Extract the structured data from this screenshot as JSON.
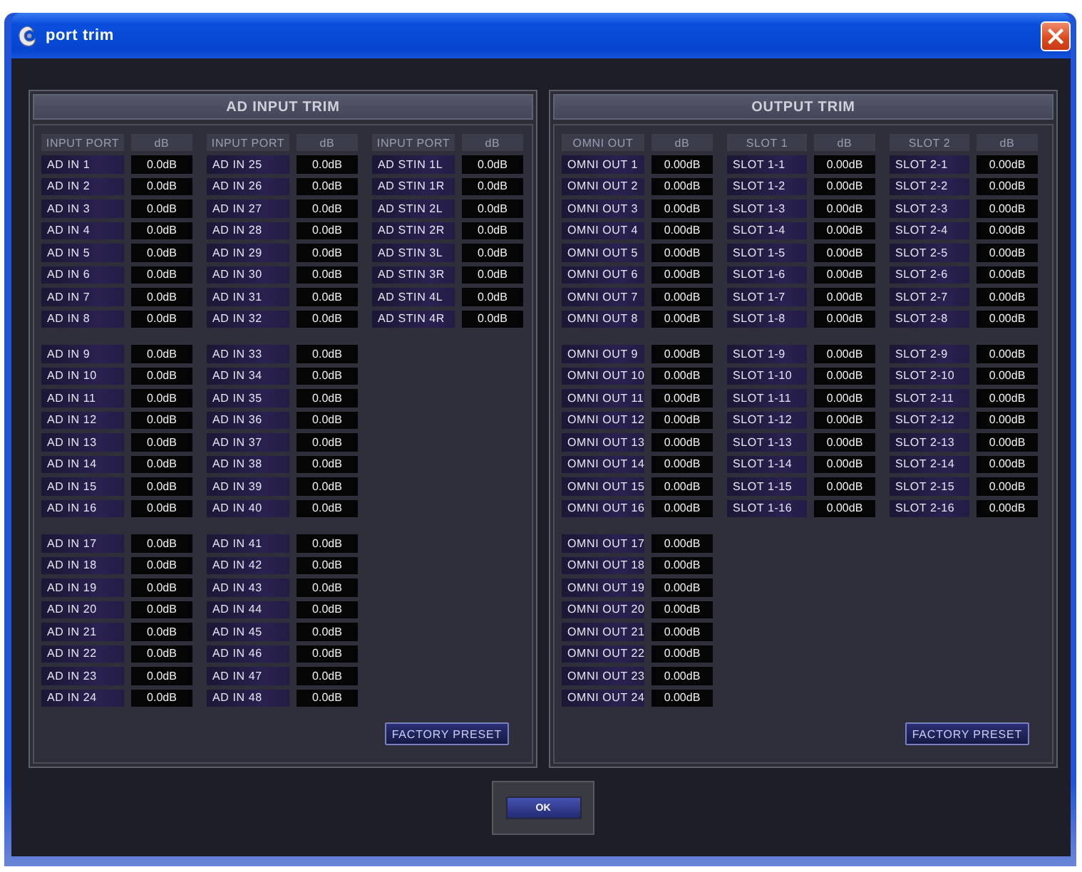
{
  "window": {
    "title": "port trim"
  },
  "panels": [
    {
      "title": "AD INPUT TRIM",
      "columns": [
        {
          "name_header": "INPUT PORT",
          "value_header": "dB",
          "blocks": [
            {
              "rows": [
                {
                  "name": "AD IN 1",
                  "trim": "0.0dB"
                },
                {
                  "name": "AD IN 2",
                  "trim": "0.0dB"
                },
                {
                  "name": "AD IN 3",
                  "trim": "0.0dB"
                },
                {
                  "name": "AD IN 4",
                  "trim": "0.0dB"
                },
                {
                  "name": "AD IN 5",
                  "trim": "0.0dB"
                },
                {
                  "name": "AD IN 6",
                  "trim": "0.0dB"
                },
                {
                  "name": "AD IN 7",
                  "trim": "0.0dB"
                },
                {
                  "name": "AD IN 8",
                  "trim": "0.0dB"
                }
              ]
            },
            {
              "rows": [
                {
                  "name": "AD IN 9",
                  "trim": "0.0dB"
                },
                {
                  "name": "AD IN 10",
                  "trim": "0.0dB"
                },
                {
                  "name": "AD IN 11",
                  "trim": "0.0dB"
                },
                {
                  "name": "AD IN 12",
                  "trim": "0.0dB"
                },
                {
                  "name": "AD IN 13",
                  "trim": "0.0dB"
                },
                {
                  "name": "AD IN 14",
                  "trim": "0.0dB"
                },
                {
                  "name": "AD IN 15",
                  "trim": "0.0dB"
                },
                {
                  "name": "AD IN 16",
                  "trim": "0.0dB"
                }
              ]
            },
            {
              "rows": [
                {
                  "name": "AD IN 17",
                  "trim": "0.0dB"
                },
                {
                  "name": "AD IN 18",
                  "trim": "0.0dB"
                },
                {
                  "name": "AD IN 19",
                  "trim": "0.0dB"
                },
                {
                  "name": "AD IN 20",
                  "trim": "0.0dB"
                },
                {
                  "name": "AD IN 21",
                  "trim": "0.0dB"
                },
                {
                  "name": "AD IN 22",
                  "trim": "0.0dB"
                },
                {
                  "name": "AD IN 23",
                  "trim": "0.0dB"
                },
                {
                  "name": "AD IN 24",
                  "trim": "0.0dB"
                }
              ]
            }
          ]
        },
        {
          "name_header": "INPUT PORT",
          "value_header": "dB",
          "blocks": [
            {
              "rows": [
                {
                  "name": "AD IN 25",
                  "trim": "0.0dB"
                },
                {
                  "name": "AD IN 26",
                  "trim": "0.0dB"
                },
                {
                  "name": "AD IN 27",
                  "trim": "0.0dB"
                },
                {
                  "name": "AD IN 28",
                  "trim": "0.0dB"
                },
                {
                  "name": "AD IN 29",
                  "trim": "0.0dB"
                },
                {
                  "name": "AD IN 30",
                  "trim": "0.0dB"
                },
                {
                  "name": "AD IN 31",
                  "trim": "0.0dB"
                },
                {
                  "name": "AD IN 32",
                  "trim": "0.0dB"
                }
              ]
            },
            {
              "rows": [
                {
                  "name": "AD IN 33",
                  "trim": "0.0dB"
                },
                {
                  "name": "AD IN 34",
                  "trim": "0.0dB"
                },
                {
                  "name": "AD IN 35",
                  "trim": "0.0dB"
                },
                {
                  "name": "AD IN 36",
                  "trim": "0.0dB"
                },
                {
                  "name": "AD IN 37",
                  "trim": "0.0dB"
                },
                {
                  "name": "AD IN 38",
                  "trim": "0.0dB"
                },
                {
                  "name": "AD IN 39",
                  "trim": "0.0dB"
                },
                {
                  "name": "AD IN 40",
                  "trim": "0.0dB"
                }
              ]
            },
            {
              "rows": [
                {
                  "name": "AD IN 41",
                  "trim": "0.0dB"
                },
                {
                  "name": "AD IN 42",
                  "trim": "0.0dB"
                },
                {
                  "name": "AD IN 43",
                  "trim": "0.0dB"
                },
                {
                  "name": "AD IN 44",
                  "trim": "0.0dB"
                },
                {
                  "name": "AD IN 45",
                  "trim": "0.0dB"
                },
                {
                  "name": "AD IN 46",
                  "trim": "0.0dB"
                },
                {
                  "name": "AD IN 47",
                  "trim": "0.0dB"
                },
                {
                  "name": "AD IN 48",
                  "trim": "0.0dB"
                }
              ]
            }
          ]
        },
        {
          "name_header": "INPUT PORT",
          "value_header": "dB",
          "blocks": [
            {
              "rows": [
                {
                  "name": "AD STIN 1L",
                  "trim": "0.0dB"
                },
                {
                  "name": "AD STIN 1R",
                  "trim": "0.0dB"
                },
                {
                  "name": "AD STIN 2L",
                  "trim": "0.0dB"
                },
                {
                  "name": "AD STIN 2R",
                  "trim": "0.0dB"
                },
                {
                  "name": "AD STIN 3L",
                  "trim": "0.0dB"
                },
                {
                  "name": "AD STIN 3R",
                  "trim": "0.0dB"
                },
                {
                  "name": "AD STIN 4L",
                  "trim": "0.0dB"
                },
                {
                  "name": "AD STIN 4R",
                  "trim": "0.0dB"
                }
              ]
            }
          ]
        }
      ],
      "factory_preset_button": "FACTORY PRESET"
    },
    {
      "title": "OUTPUT TRIM",
      "columns": [
        {
          "name_header": "OMNI OUT",
          "value_header": "dB",
          "blocks": [
            {
              "rows": [
                {
                  "name": "OMNI OUT 1",
                  "trim": "0.00dB"
                },
                {
                  "name": "OMNI OUT 2",
                  "trim": "0.00dB"
                },
                {
                  "name": "OMNI OUT 3",
                  "trim": "0.00dB"
                },
                {
                  "name": "OMNI OUT 4",
                  "trim": "0.00dB"
                },
                {
                  "name": "OMNI OUT 5",
                  "trim": "0.00dB"
                },
                {
                  "name": "OMNI OUT 6",
                  "trim": "0.00dB"
                },
                {
                  "name": "OMNI OUT 7",
                  "trim": "0.00dB"
                },
                {
                  "name": "OMNI OUT 8",
                  "trim": "0.00dB"
                }
              ]
            },
            {
              "rows": [
                {
                  "name": "OMNI OUT 9",
                  "trim": "0.00dB"
                },
                {
                  "name": "OMNI OUT 10",
                  "trim": "0.00dB"
                },
                {
                  "name": "OMNI OUT 11",
                  "trim": "0.00dB"
                },
                {
                  "name": "OMNI OUT 12",
                  "trim": "0.00dB"
                },
                {
                  "name": "OMNI OUT 13",
                  "trim": "0.00dB"
                },
                {
                  "name": "OMNI OUT 14",
                  "trim": "0.00dB"
                },
                {
                  "name": "OMNI OUT 15",
                  "trim": "0.00dB"
                },
                {
                  "name": "OMNI OUT 16",
                  "trim": "0.00dB"
                }
              ]
            },
            {
              "rows": [
                {
                  "name": "OMNI OUT 17",
                  "trim": "0.00dB"
                },
                {
                  "name": "OMNI OUT 18",
                  "trim": "0.00dB"
                },
                {
                  "name": "OMNI OUT 19",
                  "trim": "0.00dB"
                },
                {
                  "name": "OMNI OUT 20",
                  "trim": "0.00dB"
                },
                {
                  "name": "OMNI OUT 21",
                  "trim": "0.00dB"
                },
                {
                  "name": "OMNI OUT 22",
                  "trim": "0.00dB"
                },
                {
                  "name": "OMNI OUT 23",
                  "trim": "0.00dB"
                },
                {
                  "name": "OMNI OUT 24",
                  "trim": "0.00dB"
                }
              ]
            }
          ]
        },
        {
          "name_header": "SLOT 1",
          "value_header": "dB",
          "blocks": [
            {
              "rows": [
                {
                  "name": "SLOT 1-1",
                  "trim": "0.00dB"
                },
                {
                  "name": "SLOT 1-2",
                  "trim": "0.00dB"
                },
                {
                  "name": "SLOT 1-3",
                  "trim": "0.00dB"
                },
                {
                  "name": "SLOT 1-4",
                  "trim": "0.00dB"
                },
                {
                  "name": "SLOT 1-5",
                  "trim": "0.00dB"
                },
                {
                  "name": "SLOT 1-6",
                  "trim": "0.00dB"
                },
                {
                  "name": "SLOT 1-7",
                  "trim": "0.00dB"
                },
                {
                  "name": "SLOT 1-8",
                  "trim": "0.00dB"
                }
              ]
            },
            {
              "rows": [
                {
                  "name": "SLOT 1-9",
                  "trim": "0.00dB"
                },
                {
                  "name": "SLOT 1-10",
                  "trim": "0.00dB"
                },
                {
                  "name": "SLOT 1-11",
                  "trim": "0.00dB"
                },
                {
                  "name": "SLOT 1-12",
                  "trim": "0.00dB"
                },
                {
                  "name": "SLOT 1-13",
                  "trim": "0.00dB"
                },
                {
                  "name": "SLOT 1-14",
                  "trim": "0.00dB"
                },
                {
                  "name": "SLOT 1-15",
                  "trim": "0.00dB"
                },
                {
                  "name": "SLOT 1-16",
                  "trim": "0.00dB"
                }
              ]
            }
          ]
        },
        {
          "name_header": "SLOT 2",
          "value_header": "dB",
          "blocks": [
            {
              "rows": [
                {
                  "name": "SLOT 2-1",
                  "trim": "0.00dB"
                },
                {
                  "name": "SLOT 2-2",
                  "trim": "0.00dB"
                },
                {
                  "name": "SLOT 2-3",
                  "trim": "0.00dB"
                },
                {
                  "name": "SLOT 2-4",
                  "trim": "0.00dB"
                },
                {
                  "name": "SLOT 2-5",
                  "trim": "0.00dB"
                },
                {
                  "name": "SLOT 2-6",
                  "trim": "0.00dB"
                },
                {
                  "name": "SLOT 2-7",
                  "trim": "0.00dB"
                },
                {
                  "name": "SLOT 2-8",
                  "trim": "0.00dB"
                }
              ]
            },
            {
              "rows": [
                {
                  "name": "SLOT 2-9",
                  "trim": "0.00dB"
                },
                {
                  "name": "SLOT 2-10",
                  "trim": "0.00dB"
                },
                {
                  "name": "SLOT 2-11",
                  "trim": "0.00dB"
                },
                {
                  "name": "SLOT 2-12",
                  "trim": "0.00dB"
                },
                {
                  "name": "SLOT 2-13",
                  "trim": "0.00dB"
                },
                {
                  "name": "SLOT 2-14",
                  "trim": "0.00dB"
                },
                {
                  "name": "SLOT 2-15",
                  "trim": "0.00dB"
                },
                {
                  "name": "SLOT 2-16",
                  "trim": "0.00dB"
                }
              ]
            }
          ]
        }
      ],
      "factory_preset_button": "FACTORY PRESET"
    }
  ],
  "ok_button": "OK"
}
